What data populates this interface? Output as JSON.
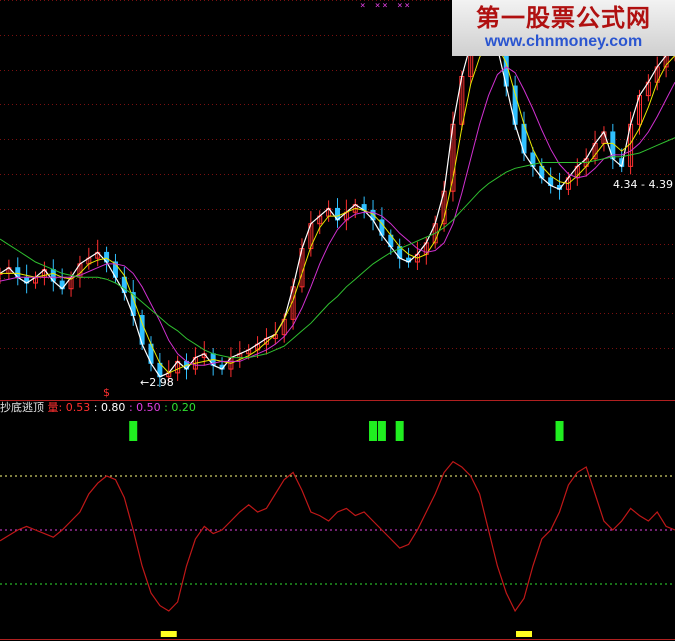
{
  "watermark": {
    "title_cn": "第一股票公式网",
    "url": "www.chnmoney.com"
  },
  "top_marks": "× ×× ××",
  "price_panel": {
    "low_label": "2.98",
    "right_label": "4.34 - 4.39"
  },
  "indicator_panel": {
    "name": "抄底逃顶",
    "first_label": "量:",
    "values": [
      "0.53",
      "0.80",
      "0.50",
      "0.20"
    ],
    "value_colors": [
      "#ff3030",
      "#ffffff",
      "#e040e0",
      "#30e030"
    ],
    "signal_marker": "$"
  },
  "colors": {
    "background": "#000000",
    "grid": "#7a1010",
    "up": "#ff3030",
    "down": "#30c0ff",
    "ma_short": "#ffffff",
    "ma_mid": "#e8e800",
    "ma_long": "#d030d0",
    "ma_longest": "#30c030",
    "indicator_line": "#c01818",
    "top_signal": "#20ee20",
    "bottom_signal": "#ffff20"
  },
  "chart_data": {
    "type": "line",
    "series": [
      {
        "values": [
          3.52,
          3.55,
          3.5,
          3.47,
          3.5,
          3.54,
          3.48,
          3.44,
          3.5,
          3.57,
          3.6,
          3.63,
          3.58,
          3.5,
          3.42,
          3.3,
          3.15,
          3.05,
          2.98,
          3.0,
          3.06,
          3.02,
          3.08,
          3.1,
          3.04,
          3.02,
          3.08,
          3.1,
          3.12,
          3.15,
          3.18,
          3.2,
          3.28,
          3.45,
          3.65,
          3.78,
          3.82,
          3.86,
          3.8,
          3.84,
          3.88,
          3.85,
          3.8,
          3.72,
          3.66,
          3.6,
          3.58,
          3.62,
          3.68,
          3.78,
          3.95,
          4.3,
          4.55,
          4.72,
          4.8,
          4.86,
          4.7,
          4.5,
          4.3,
          4.15,
          4.08,
          4.02,
          3.98,
          3.96,
          4.02,
          4.08,
          4.12,
          4.2,
          4.26,
          4.12,
          4.08,
          4.3,
          4.45,
          4.52,
          4.6,
          4.66,
          4.7
        ]
      },
      {
        "values": [
          3.52,
          3.52,
          3.52,
          3.51,
          3.5,
          3.51,
          3.52,
          3.5,
          3.49,
          3.52,
          3.57,
          3.59,
          3.6,
          3.57,
          3.51,
          3.39,
          3.26,
          3.15,
          3.05,
          3.0,
          3.02,
          3.04,
          3.05,
          3.06,
          3.07,
          3.06,
          3.05,
          3.07,
          3.09,
          3.12,
          3.16,
          3.2,
          3.28,
          3.38,
          3.52,
          3.66,
          3.76,
          3.82,
          3.82,
          3.84,
          3.86,
          3.85,
          3.83,
          3.78,
          3.72,
          3.66,
          3.62,
          3.6,
          3.62,
          3.69,
          3.81,
          4.02,
          4.28,
          4.51,
          4.65,
          4.74,
          4.71,
          4.62,
          4.46,
          4.3,
          4.17,
          4.08,
          4.03,
          4.0,
          3.99,
          4.03,
          4.08,
          4.14,
          4.2,
          4.2,
          4.16,
          4.2,
          4.28,
          4.39,
          4.52,
          4.61,
          4.66
        ]
      },
      {
        "values": [
          3.48,
          3.49,
          3.5,
          3.5,
          3.5,
          3.5,
          3.5,
          3.5,
          3.5,
          3.51,
          3.53,
          3.55,
          3.57,
          3.57,
          3.56,
          3.52,
          3.45,
          3.36,
          3.27,
          3.17,
          3.1,
          3.06,
          3.04,
          3.04,
          3.05,
          3.06,
          3.06,
          3.06,
          3.08,
          3.1,
          3.12,
          3.15,
          3.19,
          3.25,
          3.34,
          3.45,
          3.57,
          3.67,
          3.75,
          3.8,
          3.83,
          3.84,
          3.84,
          3.82,
          3.78,
          3.73,
          3.69,
          3.65,
          3.63,
          3.64,
          3.68,
          3.78,
          3.94,
          4.12,
          4.3,
          4.45,
          4.56,
          4.6,
          4.57,
          4.48,
          4.38,
          4.27,
          4.17,
          4.09,
          4.04,
          4.02,
          4.03,
          4.07,
          4.12,
          4.14,
          4.14,
          4.16,
          4.2,
          4.26,
          4.34,
          4.43,
          4.52
        ]
      },
      {
        "values": [
          3.7,
          3.67,
          3.64,
          3.61,
          3.58,
          3.56,
          3.54,
          3.52,
          3.51,
          3.5,
          3.5,
          3.5,
          3.49,
          3.47,
          3.44,
          3.41,
          3.37,
          3.33,
          3.29,
          3.25,
          3.22,
          3.18,
          3.15,
          3.12,
          3.1,
          3.09,
          3.08,
          3.08,
          3.08,
          3.09,
          3.1,
          3.12,
          3.14,
          3.18,
          3.22,
          3.26,
          3.31,
          3.36,
          3.4,
          3.45,
          3.49,
          3.53,
          3.57,
          3.6,
          3.63,
          3.65,
          3.67,
          3.69,
          3.71,
          3.73,
          3.76,
          3.8,
          3.85,
          3.9,
          3.95,
          3.99,
          4.02,
          4.05,
          4.07,
          4.08,
          4.09,
          4.1,
          4.1,
          4.1,
          4.1,
          4.1,
          4.1,
          4.11,
          4.12,
          4.13,
          4.13,
          4.14,
          4.15,
          4.17,
          4.19,
          4.21,
          4.23
        ]
      },
      {
        "values": [
          0.44,
          0.47,
          0.5,
          0.52,
          0.5,
          0.48,
          0.46,
          0.5,
          0.55,
          0.6,
          0.7,
          0.76,
          0.8,
          0.78,
          0.68,
          0.5,
          0.3,
          0.15,
          0.08,
          0.05,
          0.1,
          0.3,
          0.45,
          0.52,
          0.48,
          0.5,
          0.55,
          0.6,
          0.64,
          0.6,
          0.62,
          0.7,
          0.78,
          0.82,
          0.72,
          0.6,
          0.58,
          0.55,
          0.6,
          0.62,
          0.58,
          0.6,
          0.55,
          0.5,
          0.45,
          0.4,
          0.42,
          0.5,
          0.6,
          0.7,
          0.82,
          0.88,
          0.85,
          0.8,
          0.7,
          0.5,
          0.3,
          0.15,
          0.05,
          0.12,
          0.3,
          0.45,
          0.5,
          0.6,
          0.75,
          0.82,
          0.85,
          0.7,
          0.55,
          0.5,
          0.55,
          0.62,
          0.58,
          0.55,
          0.6,
          0.52,
          0.5
        ]
      }
    ],
    "ylim": [
      2.9,
      4.95
    ],
    "indicator_ylim": [
      0,
      1
    ],
    "reference_lines": [
      0.8,
      0.5,
      0.2
    ],
    "top_signals": [
      15,
      42,
      43,
      45,
      63
    ],
    "bottom_signals": [
      19,
      59
    ],
    "grid": true
  }
}
